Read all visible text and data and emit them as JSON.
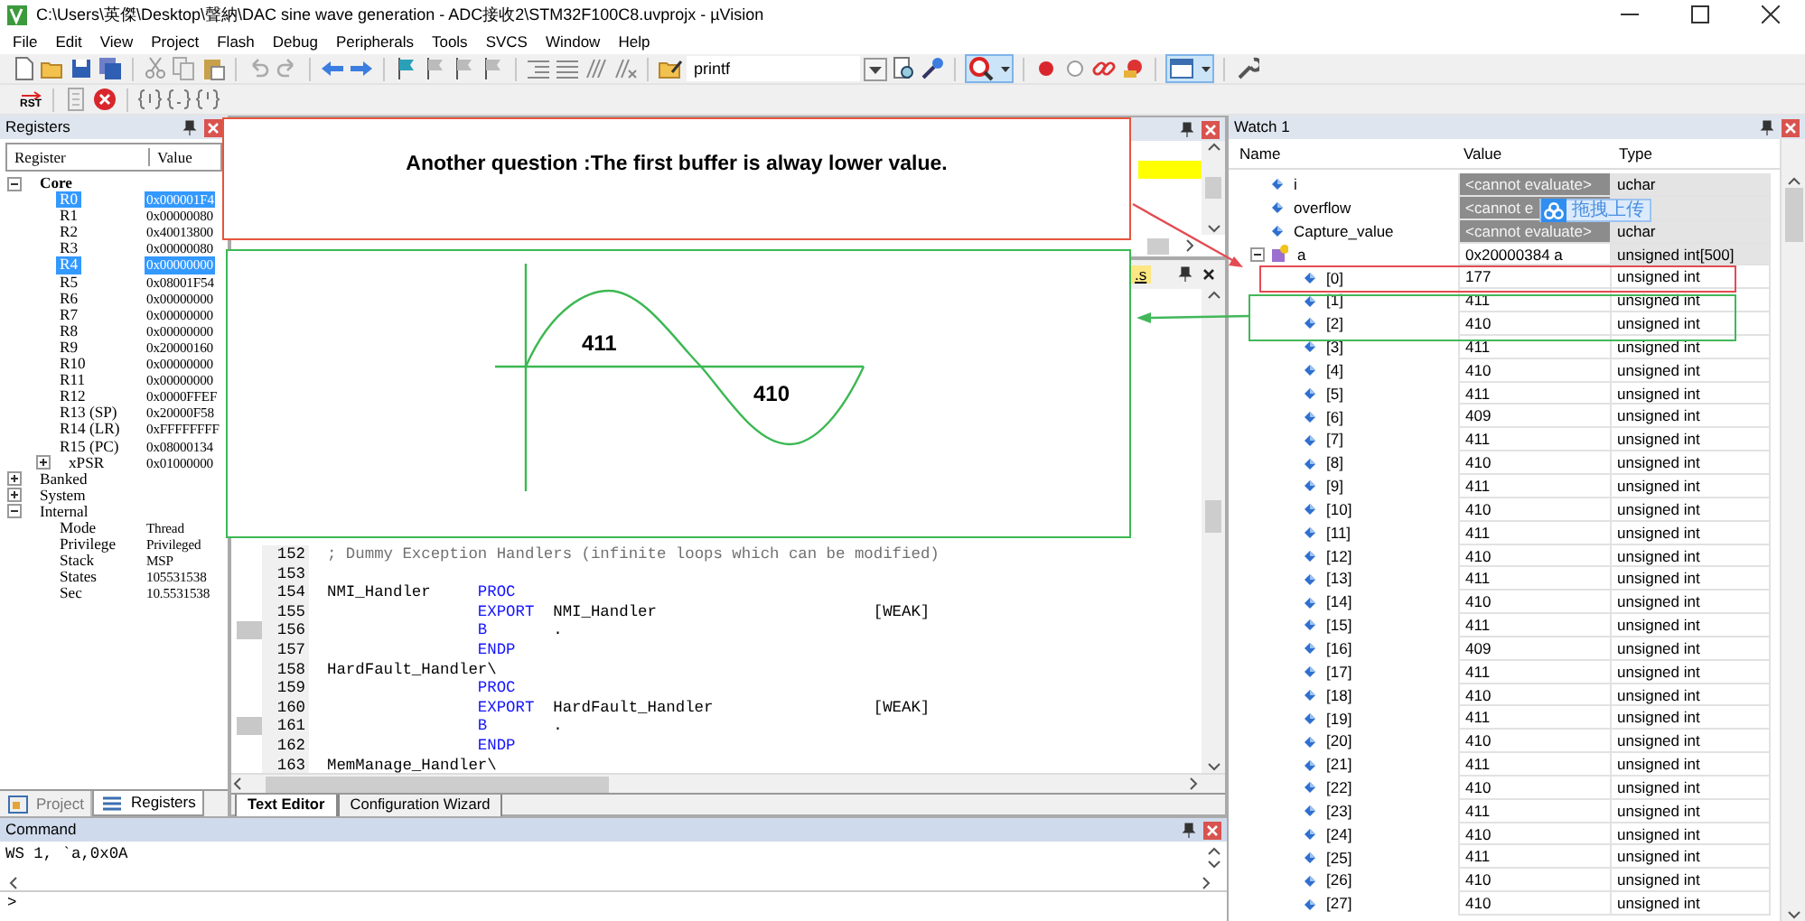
{
  "window": {
    "title": "C:\\Users\\英傑\\Desktop\\聲納\\DAC sine wave generation - ADC接收2\\STM32F100C8.uvprojx - µVision"
  },
  "menu": [
    "File",
    "Edit",
    "View",
    "Project",
    "Flash",
    "Debug",
    "Peripherals",
    "Tools",
    "SVCS",
    "Window",
    "Help"
  ],
  "toolbar": {
    "find_text": "printf"
  },
  "debug_toolbar": {
    "reset_label": "RST"
  },
  "registers": {
    "title": "Registers",
    "columns": [
      "Register",
      "Value"
    ],
    "tree": [
      {
        "name": "Core",
        "emphasized": true,
        "expanded": true,
        "selected": false,
        "children": [
          {
            "name": "R0",
            "value": "0x000001F4",
            "selected": true
          },
          {
            "name": "R1",
            "value": "0x00000080",
            "selected": false
          },
          {
            "name": "R2",
            "value": "0x40013800",
            "selected": false
          },
          {
            "name": "R3",
            "value": "0x00000080",
            "selected": false
          },
          {
            "name": "R4",
            "value": "0x00000000",
            "selected": true
          },
          {
            "name": "R5",
            "value": "0x08001F54",
            "selected": false
          },
          {
            "name": "R6",
            "value": "0x00000000",
            "selected": false
          },
          {
            "name": "R7",
            "value": "0x00000000",
            "selected": false
          },
          {
            "name": "R8",
            "value": "0x00000000",
            "selected": false
          },
          {
            "name": "R9",
            "value": "0x20000160",
            "selected": false
          },
          {
            "name": "R10",
            "value": "0x00000000",
            "selected": false
          },
          {
            "name": "R11",
            "value": "0x00000000",
            "selected": false
          },
          {
            "name": "R12",
            "value": "0x0000FFEF",
            "selected": false
          },
          {
            "name": "R13 (SP)",
            "value": "0x20000F58",
            "selected": false
          },
          {
            "name": "R14 (LR)",
            "value": "0xFFFFFFFF",
            "selected": false
          },
          {
            "name": "R15 (PC)",
            "value": "0x08000134",
            "selected": false
          },
          {
            "name": "xPSR",
            "value": "0x01000000",
            "selected": false,
            "expanded": false
          }
        ]
      },
      {
        "name": "Banked",
        "emphasized": false,
        "expanded": false,
        "selected": false
      },
      {
        "name": "System",
        "emphasized": false,
        "expanded": false,
        "selected": false
      },
      {
        "name": "Internal",
        "emphasized": false,
        "expanded": true,
        "selected": false,
        "children": [
          {
            "name": "Mode",
            "value": "Thread",
            "selected": false
          },
          {
            "name": "Privilege",
            "value": "Privileged",
            "selected": false
          },
          {
            "name": "Stack",
            "value": "MSP",
            "selected": false
          },
          {
            "name": "States",
            "value": "105531538",
            "selected": false
          },
          {
            "name": "Sec",
            "value": "10.5531538",
            "selected": false
          }
        ]
      }
    ],
    "tabs": [
      {
        "label": "Project",
        "selected": false
      },
      {
        "label": "Registers",
        "selected": true
      }
    ]
  },
  "editor": {
    "file_tab": ".s",
    "lines": [
      {
        "number": "152",
        "marker": false,
        "comment": "; Dummy Exception Handlers (infinite loops which can be modified)"
      },
      {
        "number": "153",
        "marker": false
      },
      {
        "number": "154",
        "marker": false,
        "label": "NMI_Handler",
        "op": "PROC"
      },
      {
        "number": "155",
        "marker": false,
        "op": "EXPORT",
        "arg": "NMI_Handler",
        "attr": "[WEAK]"
      },
      {
        "number": "156",
        "marker": true,
        "op": "B",
        "arg": "."
      },
      {
        "number": "157",
        "marker": false,
        "op": "ENDP"
      },
      {
        "number": "158",
        "marker": false,
        "label": "HardFault_Handler\\"
      },
      {
        "number": "159",
        "marker": false,
        "op": "PROC"
      },
      {
        "number": "160",
        "marker": false,
        "op": "EXPORT",
        "arg": "HardFault_Handler",
        "attr": "[WEAK]"
      },
      {
        "number": "161",
        "marker": true,
        "op": "B",
        "arg": "."
      },
      {
        "number": "162",
        "marker": false,
        "op": "ENDP"
      },
      {
        "number": "163",
        "marker": false,
        "label": "MemManage_Handler\\"
      }
    ],
    "tabs": [
      {
        "label": "Text Editor",
        "selected": true
      },
      {
        "label": "Configuration Wizard",
        "selected": false
      }
    ]
  },
  "command": {
    "title": "Command",
    "output": "WS 1, `a,0x0A",
    "prompt": ">"
  },
  "watch": {
    "title": "Watch 1",
    "columns": [
      "Name",
      "Value",
      "Type"
    ],
    "rows": [
      {
        "name": "i",
        "kind": "unevaluated",
        "value": "<cannot evaluate>",
        "type": "uchar"
      },
      {
        "name": "overflow",
        "kind": "unevaluated",
        "value": "<cannot e"
      },
      {
        "name": "Capture_value",
        "kind": "unevaluated",
        "value": "<cannot evaluate>",
        "type": "uchar"
      },
      {
        "name": "a",
        "kind": "array",
        "value": "0x20000384 a",
        "type": "unsigned int[500]",
        "expanded": true,
        "children": [
          {
            "name": "[0]",
            "value": "177",
            "type": "unsigned int"
          },
          {
            "name": "[1]",
            "value": "411",
            "type": "unsigned int"
          },
          {
            "name": "[2]",
            "value": "410",
            "type": "unsigned int"
          },
          {
            "name": "[3]",
            "value": "411",
            "type": "unsigned int"
          },
          {
            "name": "[4]",
            "value": "410",
            "type": "unsigned int"
          },
          {
            "name": "[5]",
            "value": "411",
            "type": "unsigned int"
          },
          {
            "name": "[6]",
            "value": "409",
            "type": "unsigned int"
          },
          {
            "name": "[7]",
            "value": "411",
            "type": "unsigned int"
          },
          {
            "name": "[8]",
            "value": "410",
            "type": "unsigned int"
          },
          {
            "name": "[9]",
            "value": "411",
            "type": "unsigned int"
          },
          {
            "name": "[10]",
            "value": "410",
            "type": "unsigned int"
          },
          {
            "name": "[11]",
            "value": "411",
            "type": "unsigned int"
          },
          {
            "name": "[12]",
            "value": "410",
            "type": "unsigned int"
          },
          {
            "name": "[13]",
            "value": "411",
            "type": "unsigned int"
          },
          {
            "name": "[14]",
            "value": "410",
            "type": "unsigned int"
          },
          {
            "name": "[15]",
            "value": "411",
            "type": "unsigned int"
          },
          {
            "name": "[16]",
            "value": "409",
            "type": "unsigned int"
          },
          {
            "name": "[17]",
            "value": "411",
            "type": "unsigned int"
          },
          {
            "name": "[18]",
            "value": "410",
            "type": "unsigned int"
          },
          {
            "name": "[19]",
            "value": "411",
            "type": "unsigned int"
          },
          {
            "name": "[20]",
            "value": "410",
            "type": "unsigned int"
          },
          {
            "name": "[21]",
            "value": "411",
            "type": "unsigned int"
          },
          {
            "name": "[22]",
            "value": "410",
            "type": "unsigned int"
          },
          {
            "name": "[23]",
            "value": "411",
            "type": "unsigned int"
          },
          {
            "name": "[24]",
            "value": "410",
            "type": "unsigned int"
          },
          {
            "name": "[25]",
            "value": "411",
            "type": "unsigned int"
          },
          {
            "name": "[26]",
            "value": "410",
            "type": "unsigned int"
          },
          {
            "name": "[27]",
            "value": "410",
            "type": "unsigned int"
          }
        ]
      }
    ]
  },
  "upload_widget": {
    "label": "拖拽上传"
  },
  "annotation": {
    "question": "Another question :The first buffer is alway lower value.",
    "wave_labels": [
      "411",
      "410"
    ]
  }
}
